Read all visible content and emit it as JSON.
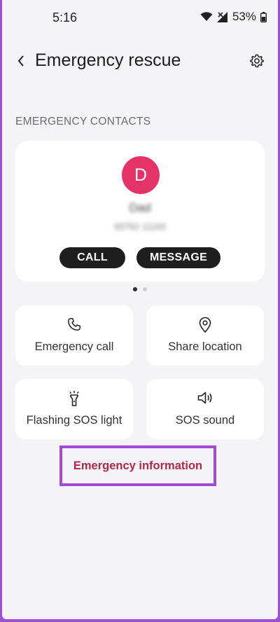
{
  "status_bar": {
    "time": "5:16",
    "battery": "53%"
  },
  "header": {
    "title": "Emergency rescue"
  },
  "contacts": {
    "section_label": "EMERGENCY CONTACTS",
    "contact": {
      "initial": "D",
      "name": "Dad",
      "number": "93762 11193"
    },
    "call_label": "CALL",
    "message_label": "MESSAGE"
  },
  "colors": {
    "avatar": "#e5336a",
    "accent": "#b5254a",
    "highlight": "#a04ad8"
  },
  "actions": [
    {
      "label": "Emergency call",
      "icon": "phone-icon"
    },
    {
      "label": "Share location",
      "icon": "location-pin-icon"
    },
    {
      "label": "Flashing SOS light",
      "icon": "flashlight-icon"
    },
    {
      "label": "SOS sound",
      "icon": "speaker-icon"
    }
  ],
  "emergency_info_label": "Emergency information"
}
